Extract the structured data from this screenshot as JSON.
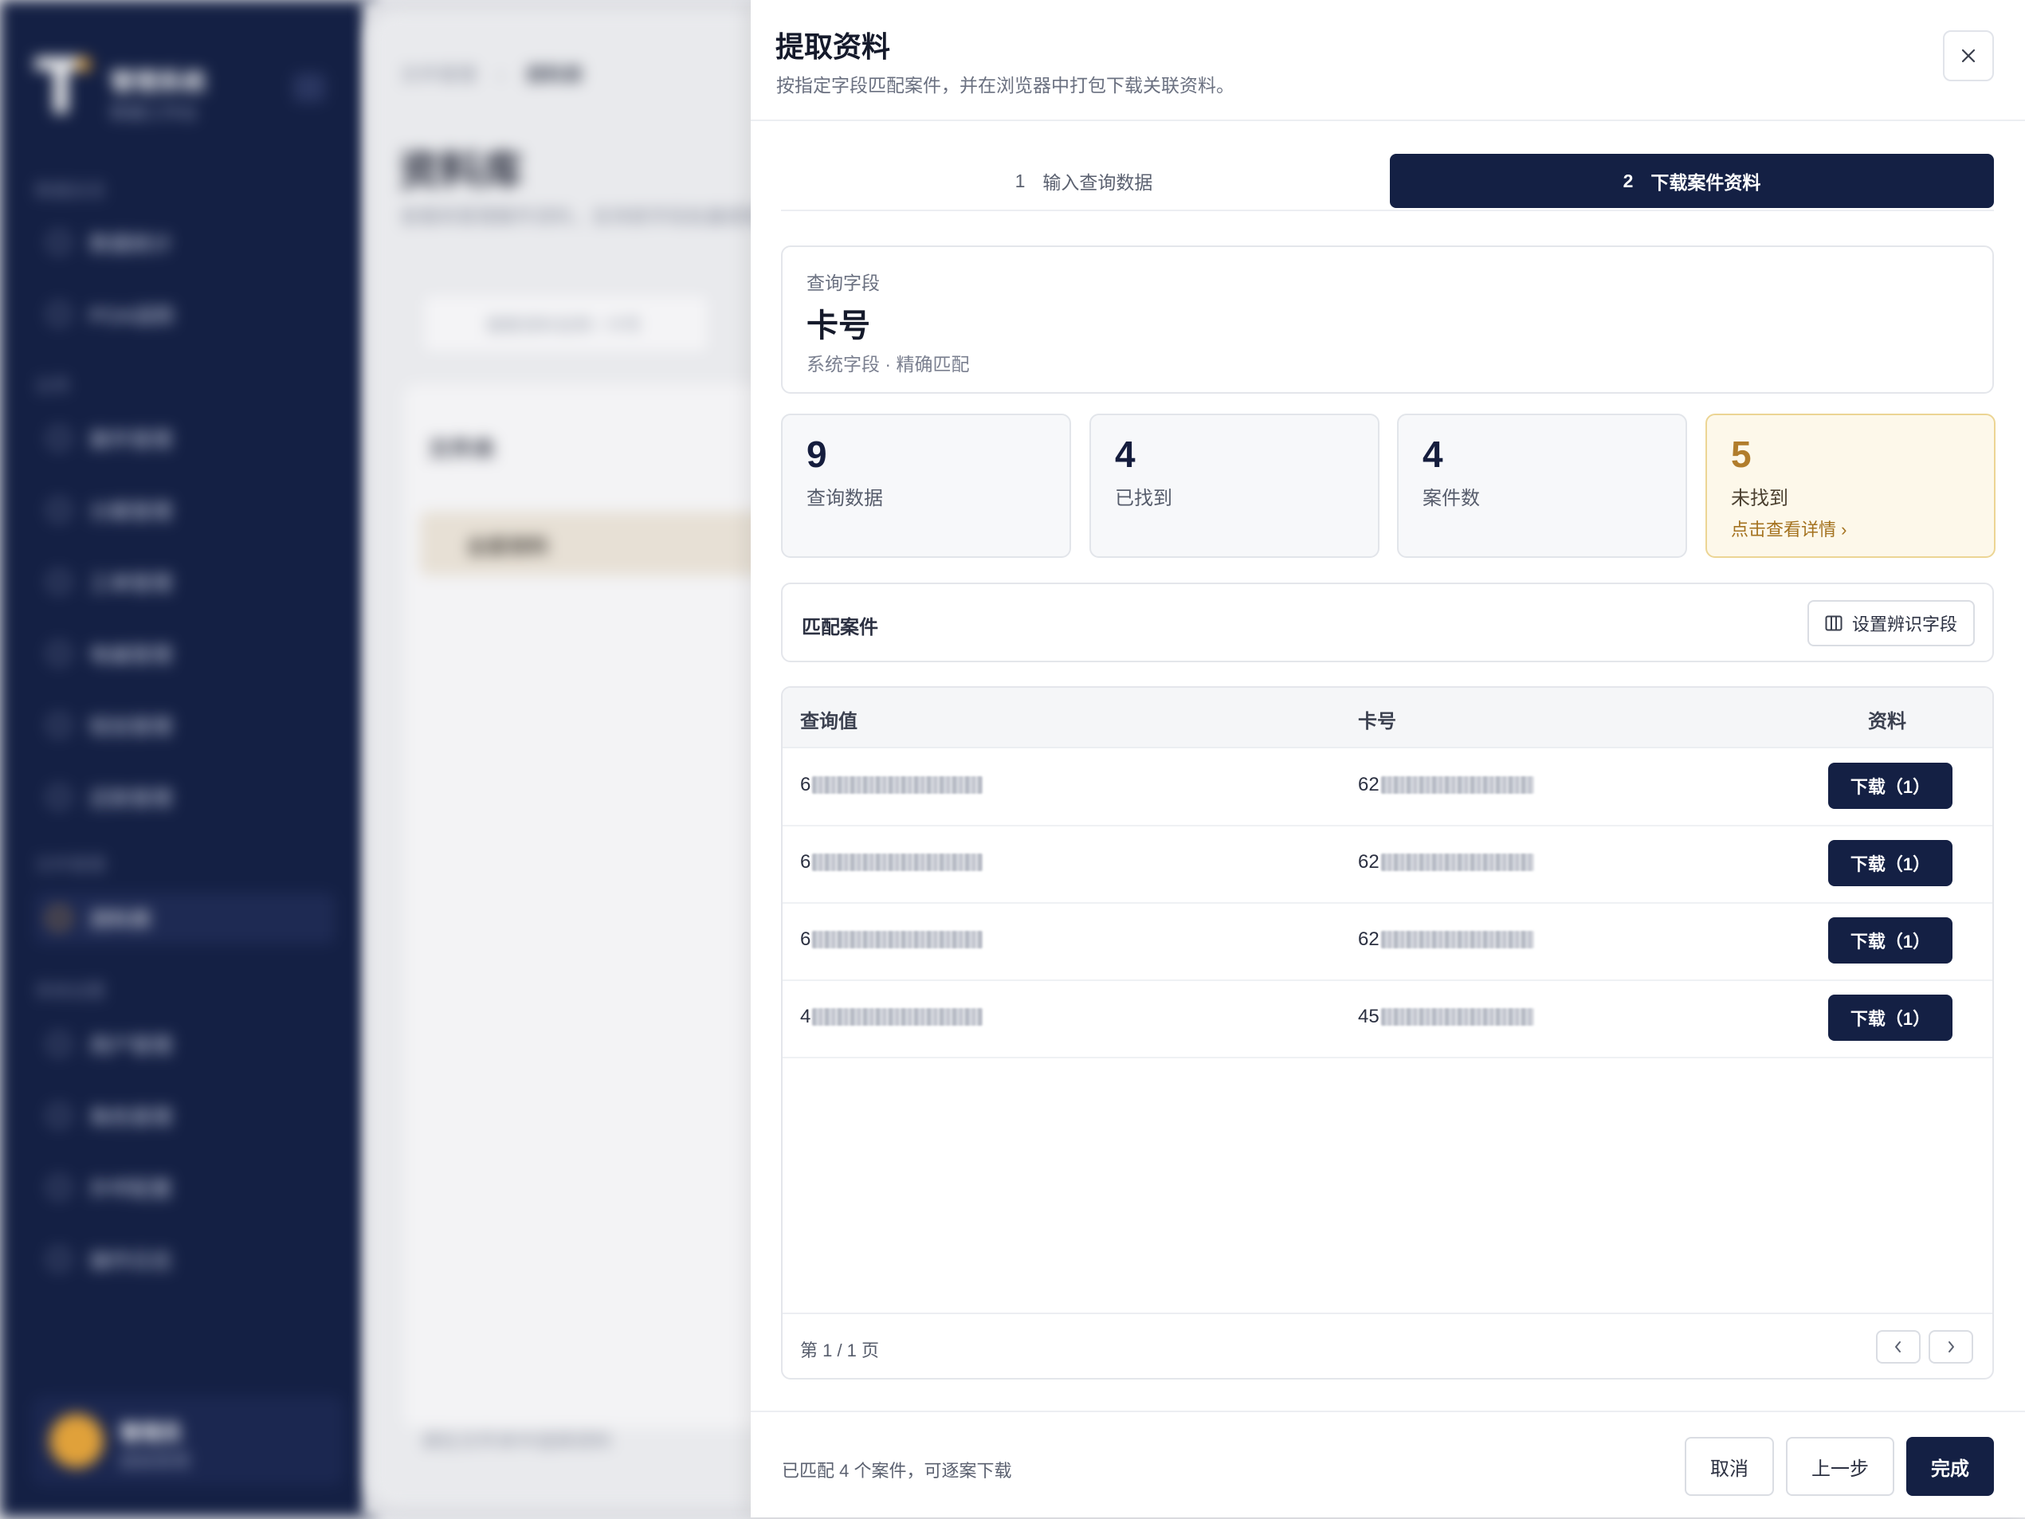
{
  "background": {
    "sidebar": {
      "brand": "管理系统",
      "brand_sub": "数据工作台",
      "groups": [
        "数据总览",
        "业务",
        "文件管理",
        "系统设置"
      ],
      "items": [
        "数据统计",
        "POA追踪",
        "案件管理",
        "分案管理",
        "工单管理",
        "电催管理",
        "短信管理",
        "还款管理",
        "资料库",
        "用户管理",
        "角色管理",
        "外呼配置",
        "操作日志"
      ],
      "active_item": "资料库",
      "user_name": "管理员",
      "user_role": "超级管理"
    },
    "breadcrumb": {
      "parent": "文件管理",
      "current": "资料库"
    },
    "page_title": "资料库",
    "page_subtitle": "查看和管理案件资料，支持按字段批量提取。",
    "search_placeholder": "搜索资料名称 / 卡号",
    "panel_title": "文件夹",
    "panel_selected": "全部资料",
    "bottom_note": "请在文件夹中选择资料"
  },
  "drawer": {
    "title": "提取资料",
    "subtitle": "按指定字段匹配案件，并在浏览器中打包下载关联资料。",
    "close_icon": "close-icon",
    "steps": [
      {
        "num": "1",
        "label": "输入查询数据",
        "active": false
      },
      {
        "num": "2",
        "label": "下载案件资料",
        "active": true
      }
    ],
    "query_field": {
      "label": "查询字段",
      "value": "卡号",
      "meta": "系统字段 · 精确匹配"
    },
    "stats": [
      {
        "value": "9",
        "label": "查询数据"
      },
      {
        "value": "4",
        "label": "已找到"
      },
      {
        "value": "4",
        "label": "案件数"
      },
      {
        "value": "5",
        "label": "未找到",
        "link": "点击查看详情 ›",
        "color": "#b17d2c"
      }
    ],
    "match": {
      "title": "匹配案件",
      "settings_button": "设置辨识字段",
      "settings_icon": "columns-icon"
    },
    "table": {
      "headers": [
        "查询值",
        "卡号",
        "资料"
      ],
      "rows": [
        {
          "query": "6",
          "card": "62",
          "download": "下载（1）"
        },
        {
          "query": "6",
          "card": "62",
          "download": "下载（1）"
        },
        {
          "query": "6",
          "card": "62",
          "download": "下载（1）"
        },
        {
          "query": "4",
          "card": "45",
          "download": "下载（1）"
        }
      ],
      "pagination": "第 1 / 1 页"
    },
    "footer": {
      "note": "已匹配 4 个案件，可逐案下载",
      "cancel": "取消",
      "prev": "上一步",
      "finish": "完成"
    },
    "colors": {
      "primary": "#142044",
      "warn": "#b17d2c",
      "warn_bg": "#fdf8ea"
    }
  }
}
